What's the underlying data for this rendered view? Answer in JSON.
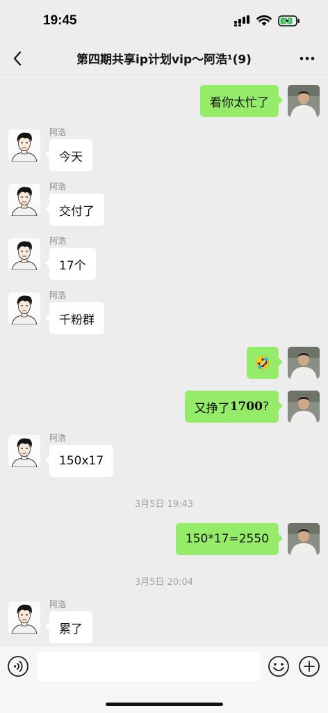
{
  "status_bar": {
    "time": "19:45"
  },
  "nav": {
    "title": "第四期共享ip计划vip～阿浩¹(9)"
  },
  "messages": [
    {
      "side": "right",
      "text": "看你太忙了"
    },
    {
      "side": "left",
      "sender": "阿浩",
      "text": "今天"
    },
    {
      "side": "left",
      "sender": "阿浩",
      "text": "交付了"
    },
    {
      "side": "left",
      "sender": "阿浩",
      "text": "17个"
    },
    {
      "side": "left",
      "sender": "阿浩",
      "text": "千粉群"
    },
    {
      "side": "right",
      "emoji": "🤣"
    },
    {
      "side": "right",
      "text_prefix": "又挣了",
      "text_number": "1700",
      "text_suffix": "?"
    },
    {
      "side": "left",
      "sender": "阿浩",
      "text": "150x17"
    },
    {
      "timestamp": "3月5日 19:43"
    },
    {
      "side": "right",
      "text": "150*17=2550"
    },
    {
      "timestamp": "3月5日 20:04"
    },
    {
      "side": "left",
      "sender": "阿浩",
      "text": "累了"
    }
  ],
  "input": {
    "value": "",
    "placeholder": ""
  },
  "colors": {
    "outgoing_bubble": "#95ec69",
    "incoming_bubble": "#ffffff",
    "background": "#ededed"
  }
}
